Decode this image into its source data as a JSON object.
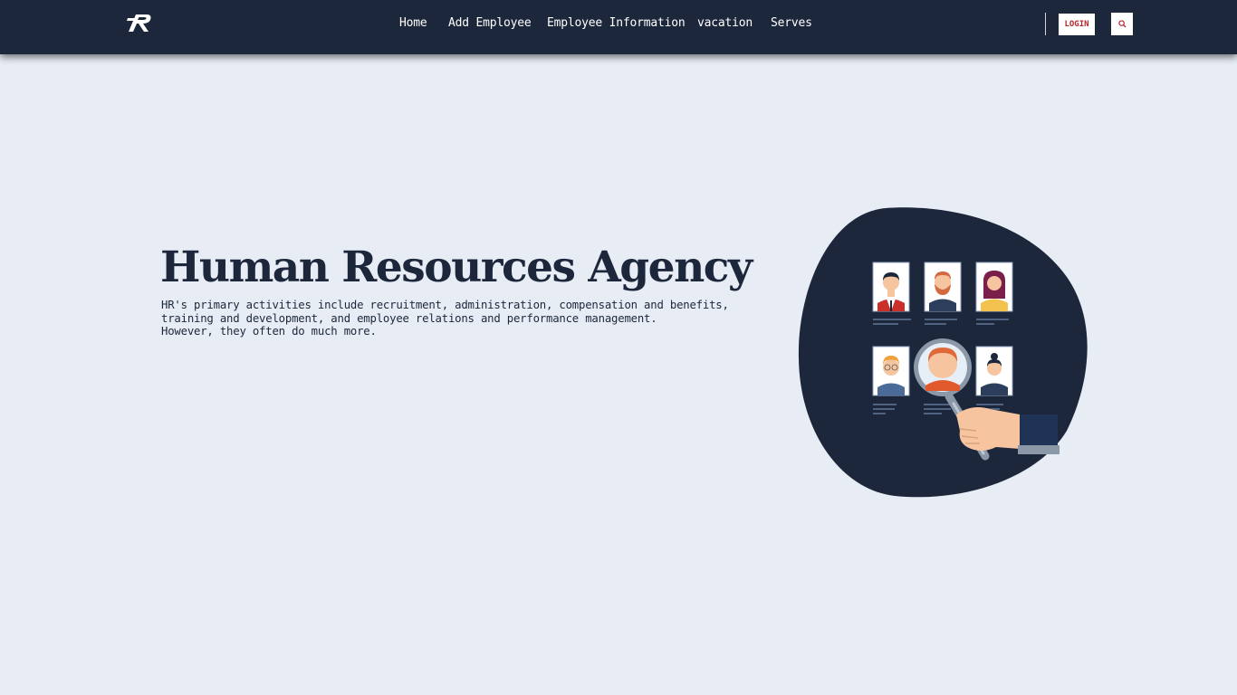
{
  "nav": {
    "links": [
      "Home",
      "Add Employee",
      "Employee Information",
      "vacation",
      "Serves"
    ],
    "login_label": "LOGIN"
  },
  "hero": {
    "title": "Human Resources Agency",
    "lines": [
      "HR's primary activities include recruitment, administration, compensation and benefits,",
      "training and development, and employee relations and performance management.",
      "However, they often do much more."
    ]
  },
  "colors": {
    "navbar_bg": "#1c273b",
    "page_bg": "#e8edf5",
    "login_text": "#b3242b",
    "blob": "#1c273b"
  },
  "icons": [
    "logo-icon",
    "search-icon",
    "magnifier-icon"
  ]
}
